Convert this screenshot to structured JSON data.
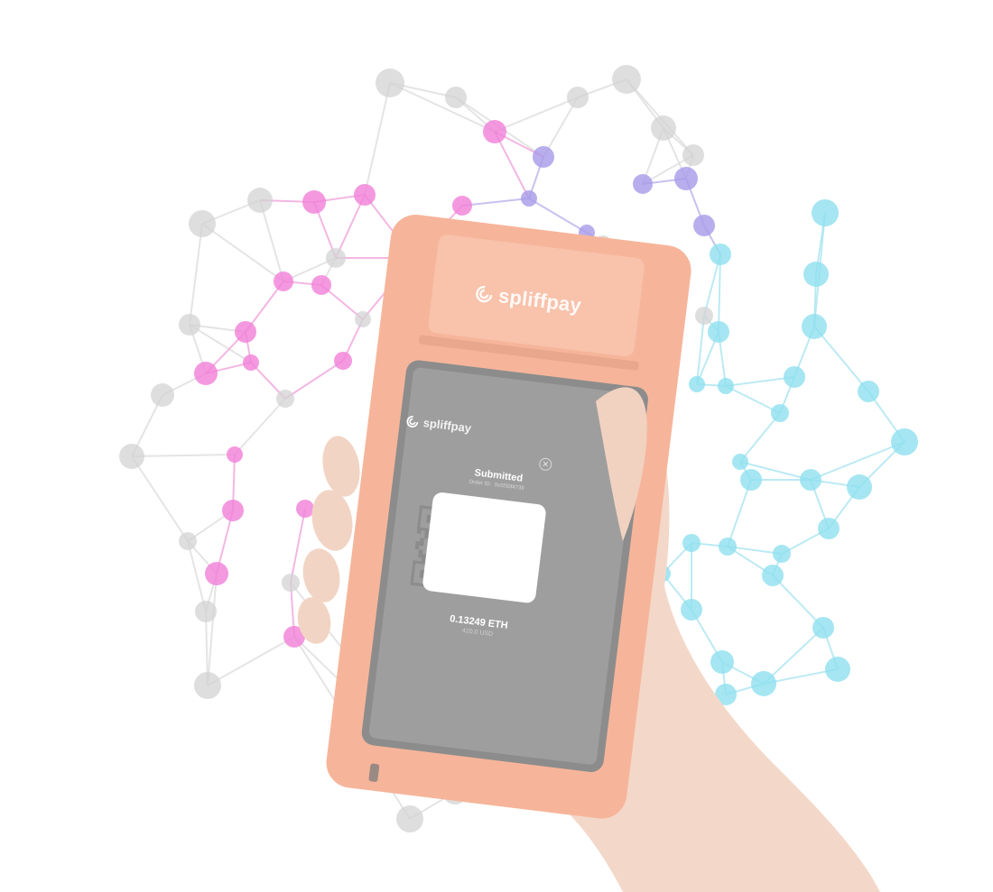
{
  "device": {
    "brand_name": "spliffpay",
    "color": "#f6b59a"
  },
  "screen": {
    "brand_name": "spliffpay",
    "close_icon": "close-circle-icon",
    "status": "Submitted",
    "order_label": "Order ID:",
    "order_id": "0x5f30f4739",
    "qr_icon": "ethereum-icon",
    "amount": "0.13249 ETH",
    "fiat": "420.0 USD"
  },
  "colors": {
    "network_pink": "#f07bd6",
    "network_purple": "#9b8fe6",
    "network_cyan": "#7fd9ec",
    "network_grey": "#d8d8d8",
    "screen_bg": "#9e9e9e",
    "skin": "#f1d3c3"
  }
}
